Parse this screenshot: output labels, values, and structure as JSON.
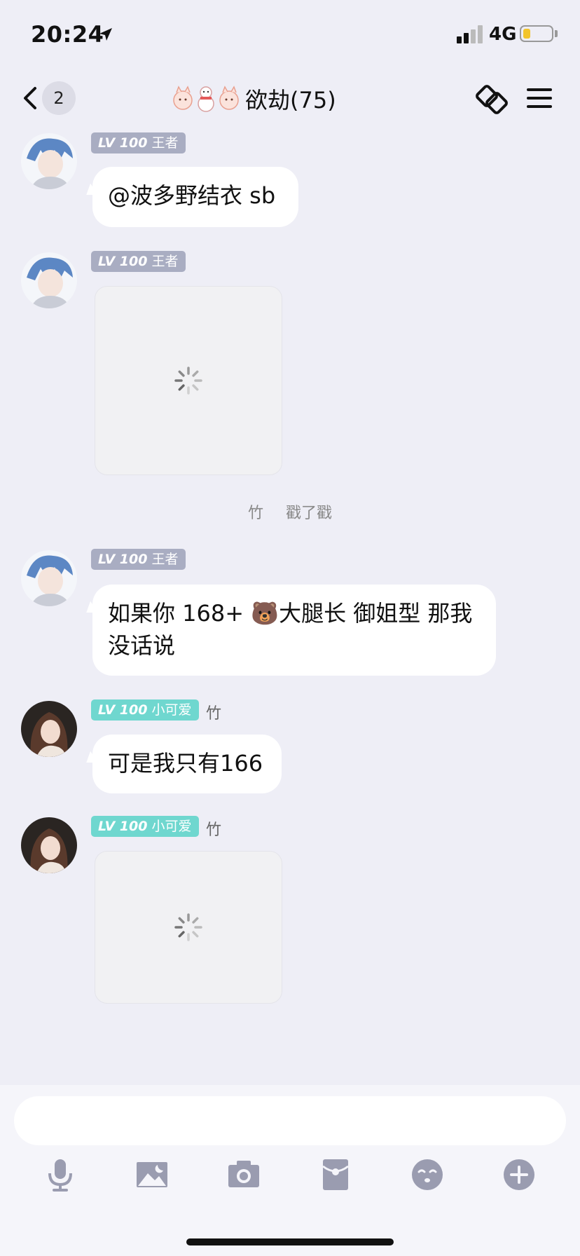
{
  "status_bar": {
    "time": "20:24",
    "network": "4G",
    "battery_level": 0.25,
    "battery_color": "#f2c42c"
  },
  "nav": {
    "back_count": "2",
    "title": "欲劫(75)"
  },
  "messages": [
    {
      "level": "LV 100",
      "title": "王者",
      "text": "@波多野结衣 sb"
    },
    {
      "level": "LV 100",
      "title": "王者",
      "content": "image-loading"
    },
    {
      "level": "LV 100",
      "title": "王者",
      "text_line1": "如果你 168+ 🐻大腿长 御姐型 那我",
      "text_line2": "没话说"
    },
    {
      "level": "LV 100",
      "title": "小可爱",
      "sender": "竹",
      "text": "可是我只有166"
    },
    {
      "level": "LV 100",
      "title": "小可爱",
      "sender": "竹",
      "content": "image-loading"
    }
  ],
  "system_message": {
    "actor": "竹",
    "action": "戳了戳"
  },
  "colors": {
    "background": "#eeeef6",
    "badge_gray": "#a9adc2",
    "badge_teal": "#6fd7cf",
    "bubble": "#ffffff",
    "toolbar_icon": "#9a9cb0"
  },
  "toolbar": {
    "icons": [
      "microphone-icon",
      "image-icon",
      "camera-icon",
      "red-packet-icon",
      "emoji-icon",
      "plus-icon"
    ]
  }
}
